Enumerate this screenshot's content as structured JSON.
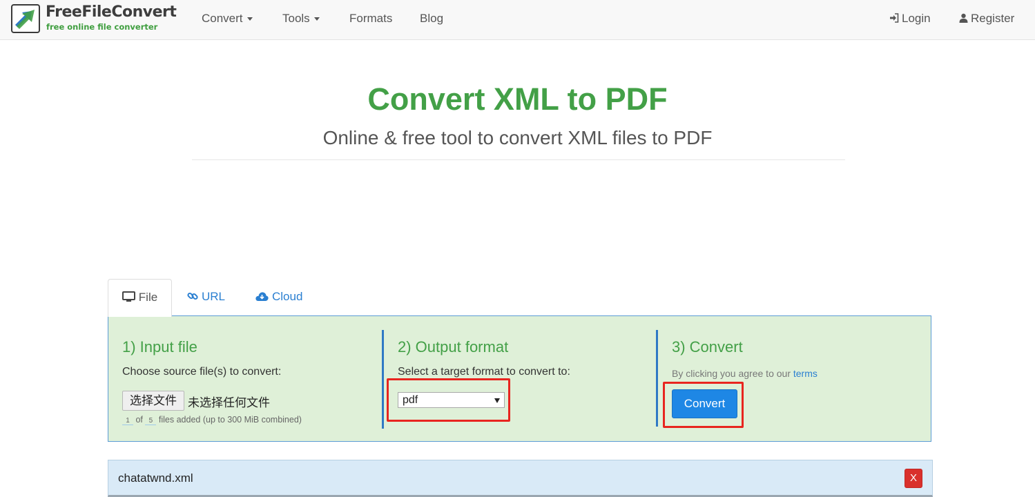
{
  "brand": {
    "name": "FreeFileConvert",
    "tagline": "free online file converter"
  },
  "nav": {
    "convert": "Convert",
    "tools": "Tools",
    "formats": "Formats",
    "blog": "Blog",
    "login": "Login",
    "register": "Register"
  },
  "hero": {
    "title": "Convert XML to PDF",
    "subtitle": "Online & free tool to convert XML files to PDF"
  },
  "tabs": {
    "file": "File",
    "url": "URL",
    "cloud": "Cloud"
  },
  "step1": {
    "title": "1) Input file",
    "desc": "Choose source file(s) to convert:",
    "choose_button": "选择文件",
    "file_status": "未选择任何文件",
    "files_added": "1",
    "of": "of",
    "files_max": "5",
    "files_note": "files added (up to 300 MiB combined)"
  },
  "step2": {
    "title": "2) Output format",
    "desc": "Select a target format to convert to:",
    "selected_format": "pdf"
  },
  "step3": {
    "title": "3) Convert",
    "agree_text": "By clicking you agree to our",
    "terms_link": "terms",
    "convert_button": "Convert"
  },
  "file_list": [
    {
      "name": "chatatwnd.xml",
      "remove_label": "X"
    }
  ],
  "colors": {
    "brand_green": "#43a047",
    "link_blue": "#2a7fd1",
    "primary_button": "#1e87e5",
    "panel_bg": "#dff0d8",
    "highlight_red": "#e8251f",
    "remove_red": "#d9302c"
  }
}
